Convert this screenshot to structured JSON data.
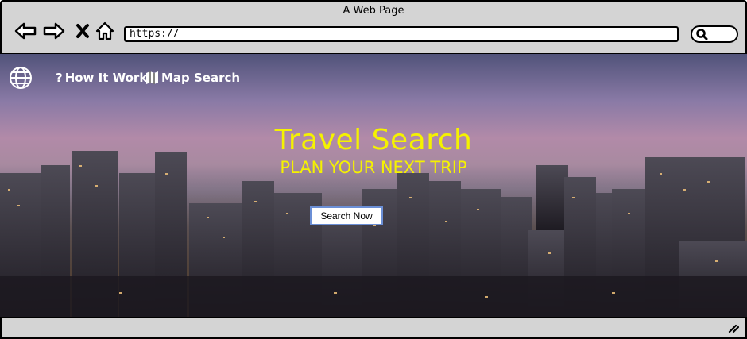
{
  "window": {
    "title": "A Web Page"
  },
  "browser": {
    "url": "https://"
  },
  "nav": {
    "how_it_works": "How It Works",
    "map_search": "Map Search"
  },
  "hero": {
    "title": "Travel Search",
    "subtitle": "PLAN YOUR NEXT TRIP",
    "cta_label": "Search Now"
  },
  "colors": {
    "headline": "#f5f200",
    "chrome": "#d4d4d4",
    "cta_border": "#6b8fd6"
  }
}
